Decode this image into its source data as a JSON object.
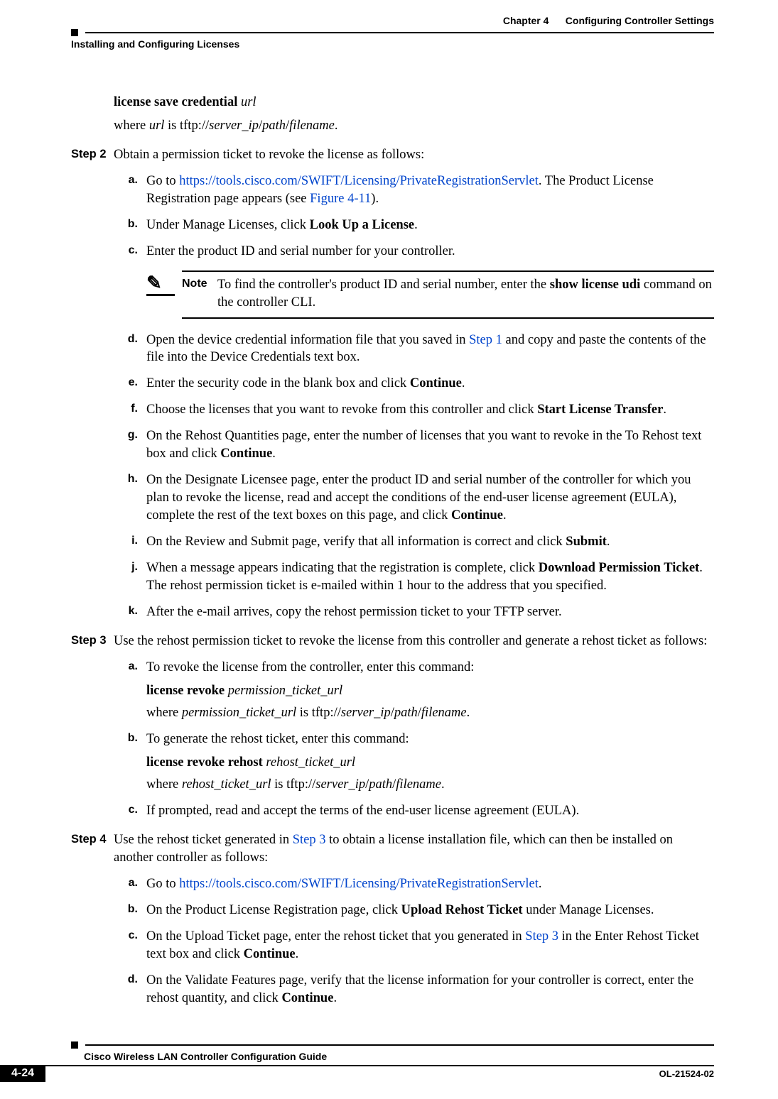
{
  "header": {
    "chapter_label": "Chapter 4",
    "chapter_title": "Configuring Controller Settings",
    "section_title": "Installing and Configuring Licenses"
  },
  "intro": {
    "cmd_prefix": "license save credential ",
    "cmd_arg": "url",
    "where_1": "where ",
    "where_url": "url",
    "where_2": " is tftp://",
    "where_server": "server_ip",
    "where_slash1": "/",
    "where_path": "path",
    "where_slash2": "/",
    "where_file": "filename",
    "where_end": "."
  },
  "step2": {
    "label": "Step 2",
    "text": "Obtain a permission ticket to revoke the license as follows:",
    "a": {
      "label": "a.",
      "t1": "Go to ",
      "url": "https://tools.cisco.com/SWIFT/Licensing/PrivateRegistrationServlet",
      "t2": ". The Product License Registration page appears (see ",
      "fig": "Figure 4-11",
      "t3": ")."
    },
    "b": {
      "label": "b.",
      "t1": "Under Manage Licenses, click ",
      "bold": "Look Up a License",
      "t2": "."
    },
    "c": {
      "label": "c.",
      "text": "Enter the product ID and serial number for your controller."
    },
    "note": {
      "label": "Note",
      "t1": "To find the controller's product ID and serial number, enter the ",
      "bold": "show license udi",
      "t2": " command on the controller CLI."
    },
    "d": {
      "label": "d.",
      "t1": "Open the device credential information file that you saved in ",
      "link": "Step 1",
      "t2": " and copy and paste the contents of the file into the Device Credentials text box."
    },
    "e": {
      "label": "e.",
      "t1": "Enter the security code in the blank box and click ",
      "bold": "Continue",
      "t2": "."
    },
    "f": {
      "label": "f.",
      "t1": "Choose the licenses that you want to revoke from this controller and click ",
      "bold": "Start License Transfer",
      "t2": "."
    },
    "g": {
      "label": "g.",
      "t1": "On the Rehost Quantities page, enter the number of licenses that you want to revoke in the To Rehost text box and click ",
      "bold": "Continue",
      "t2": "."
    },
    "h": {
      "label": "h.",
      "t1": "On the Designate Licensee page, enter the product ID and serial number of the controller for which you plan to revoke the license, read and accept the conditions of the end-user license agreement (EULA), complete the rest of the text boxes on this page, and click ",
      "bold": "Continue",
      "t2": "."
    },
    "i": {
      "label": "i.",
      "t1": "On the Review and Submit page, verify that all information is correct and click ",
      "bold": "Submit",
      "t2": "."
    },
    "j": {
      "label": "j.",
      "t1": "When a message appears indicating that the registration is complete, click ",
      "bold": "Download Permission Ticket",
      "t2": ". The rehost permission ticket is e-mailed within 1 hour to the address that you specified."
    },
    "k": {
      "label": "k.",
      "text": "After the e-mail arrives, copy the rehost permission ticket to your TFTP server."
    }
  },
  "step3": {
    "label": "Step 3",
    "text": "Use the rehost permission ticket to revoke the license from this controller and generate a rehost ticket as follows:",
    "a": {
      "label": "a.",
      "text": "To revoke the license from the controller, enter this command:",
      "cmd_bold": "license revoke ",
      "cmd_ital": "permission_ticket_url",
      "where_1": "where ",
      "where_ital": "permission_ticket_url",
      "where_2": " is tftp://",
      "where_server": "server_ip",
      "where_slash1": "/",
      "where_path": "path",
      "where_slash2": "/",
      "where_file": "filename",
      "where_end": "."
    },
    "b": {
      "label": "b.",
      "text": "To generate the rehost ticket, enter this command:",
      "cmd_bold": "license revoke rehost ",
      "cmd_ital": "rehost_ticket_url",
      "where_1": "where ",
      "where_ital": "rehost_ticket_url",
      "where_2": " is tftp://",
      "where_server": "server_ip",
      "where_slash1": "/",
      "where_path": "path",
      "where_slash2": "/",
      "where_file": "filename",
      "where_end": "."
    },
    "c": {
      "label": "c.",
      "text": "If prompted, read and accept the terms of the end-user license agreement (EULA)."
    }
  },
  "step4": {
    "label": "Step 4",
    "t1": "Use the rehost ticket generated in ",
    "link": "Step 3",
    "t2": " to obtain a license installation file, which can then be installed on another controller as follows:",
    "a": {
      "label": "a.",
      "t1": "Go to ",
      "url": "https://tools.cisco.com/SWIFT/Licensing/PrivateRegistrationServlet",
      "t2": "."
    },
    "b": {
      "label": "b.",
      "t1": "On the Product License Registration page, click ",
      "bold": "Upload Rehost Ticket",
      "t2": " under Manage Licenses."
    },
    "c": {
      "label": "c.",
      "t1": "On the Upload Ticket page, enter the rehost ticket that you generated in ",
      "link": "Step 3",
      "t2": " in the Enter Rehost Ticket text box and click ",
      "bold": "Continue",
      "t3": "."
    },
    "d": {
      "label": "d.",
      "t1": "On the Validate Features page, verify that the license information for your controller is correct, enter the rehost quantity, and click ",
      "bold": "Continue",
      "t2": "."
    }
  },
  "footer": {
    "book_title": "Cisco Wireless LAN Controller Configuration Guide",
    "page_number": "4-24",
    "doc_id": "OL-21524-02"
  }
}
